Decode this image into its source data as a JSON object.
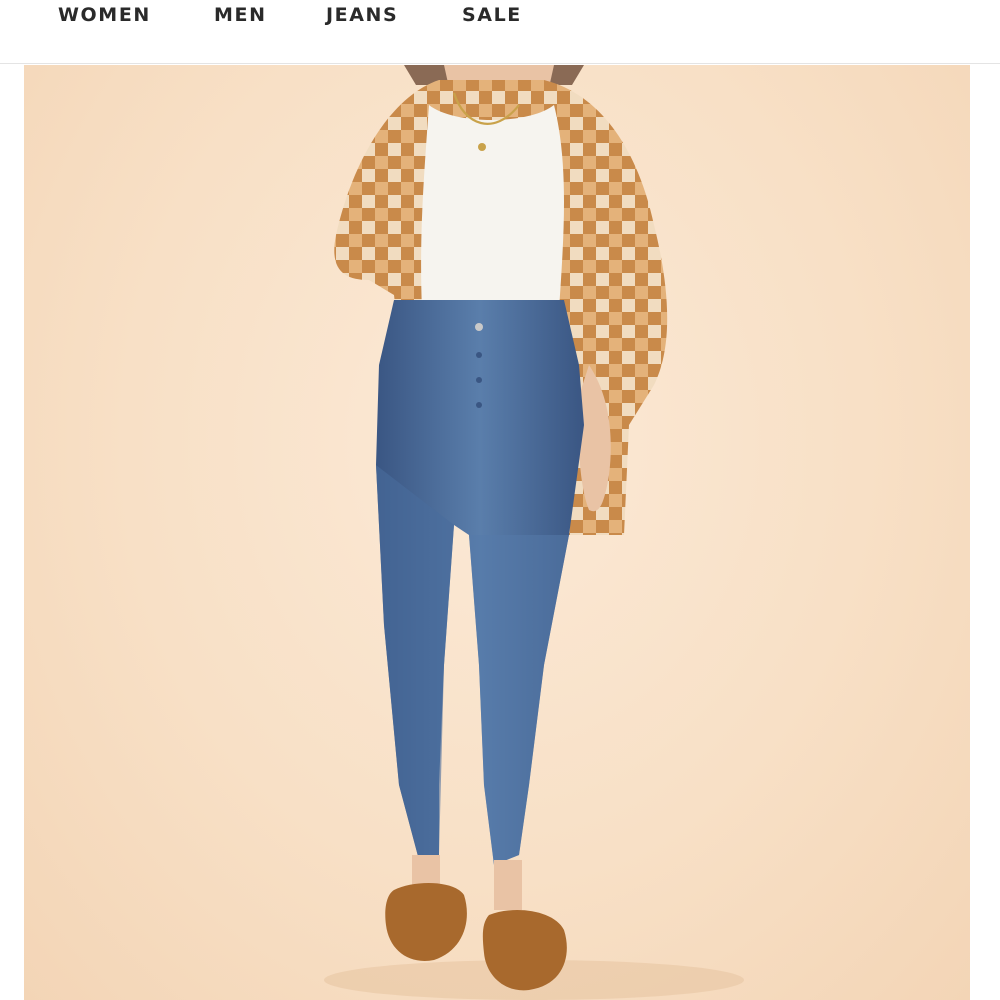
{
  "nav": {
    "items": [
      {
        "label": "WOMEN"
      },
      {
        "label": "MEN"
      },
      {
        "label": "JEANS"
      },
      {
        "label": "SALE"
      }
    ]
  },
  "hero": {
    "background_color": "#f8e0c6",
    "figure_colors": {
      "cardigan": "#c98a4a",
      "cardigan_light": "#f1dcc0",
      "top": "#f6f4ef",
      "jeans": "#4a6d9c",
      "jeans_dark": "#3a5683",
      "skin": "#e9c3a5",
      "hair": "#8a6a55",
      "shoes": "#a8692d"
    }
  }
}
